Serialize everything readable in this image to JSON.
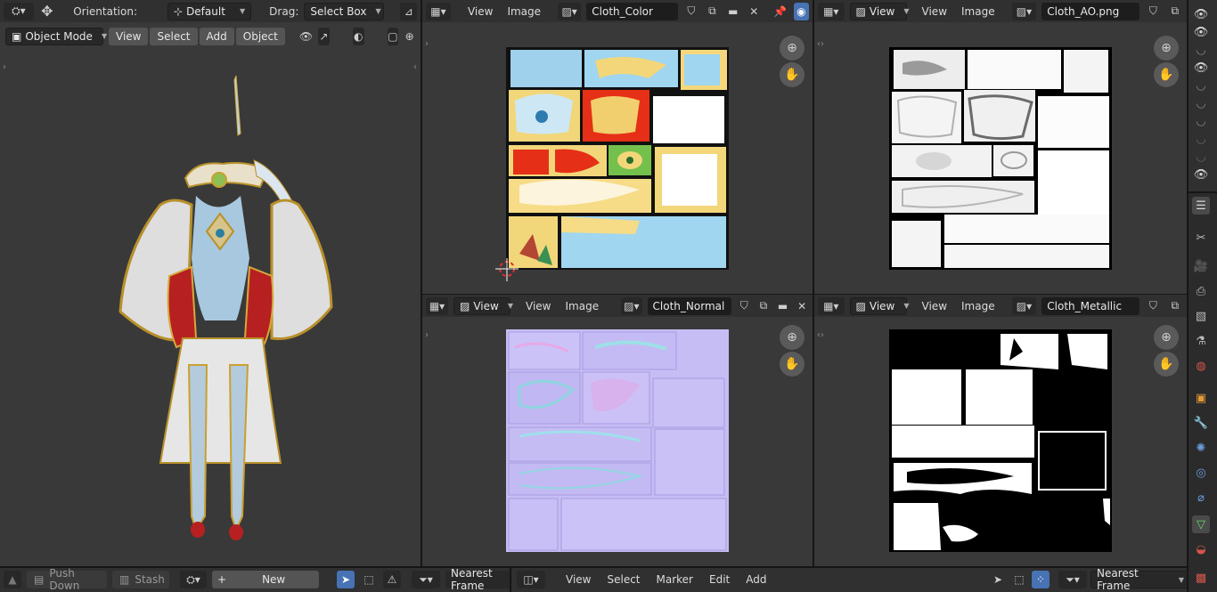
{
  "viewport3d": {
    "orientation_label": "Orientation:",
    "orientation_value": "Default",
    "drag_label": "Drag:",
    "drag_value": "Select Box",
    "mode": "Object Mode",
    "menus": [
      "View",
      "Select",
      "Add",
      "Object"
    ]
  },
  "image_editors": [
    {
      "name": "Cloth_Color",
      "menus": [
        "View",
        "Image"
      ]
    },
    {
      "name": "Cloth_AO.png",
      "view_label": "View",
      "menus": [
        "View",
        "Image"
      ]
    },
    {
      "name": "Cloth_Normal",
      "view_label": "View",
      "menus": [
        "View",
        "Image"
      ]
    },
    {
      "name": "Cloth_Metallic",
      "view_label": "View",
      "menus": [
        "View",
        "Image"
      ]
    }
  ],
  "bottom_left": {
    "push_down": "Push Down",
    "stash": "Stash",
    "new_label": "New",
    "interp": "Nearest Frame"
  },
  "bottom_right": {
    "menus": [
      "View",
      "Select",
      "Marker",
      "Edit",
      "Add"
    ],
    "interp": "Nearest Frame"
  },
  "colors": {
    "accent": "#4772b3",
    "bg": "#393939",
    "header": "#303030"
  }
}
